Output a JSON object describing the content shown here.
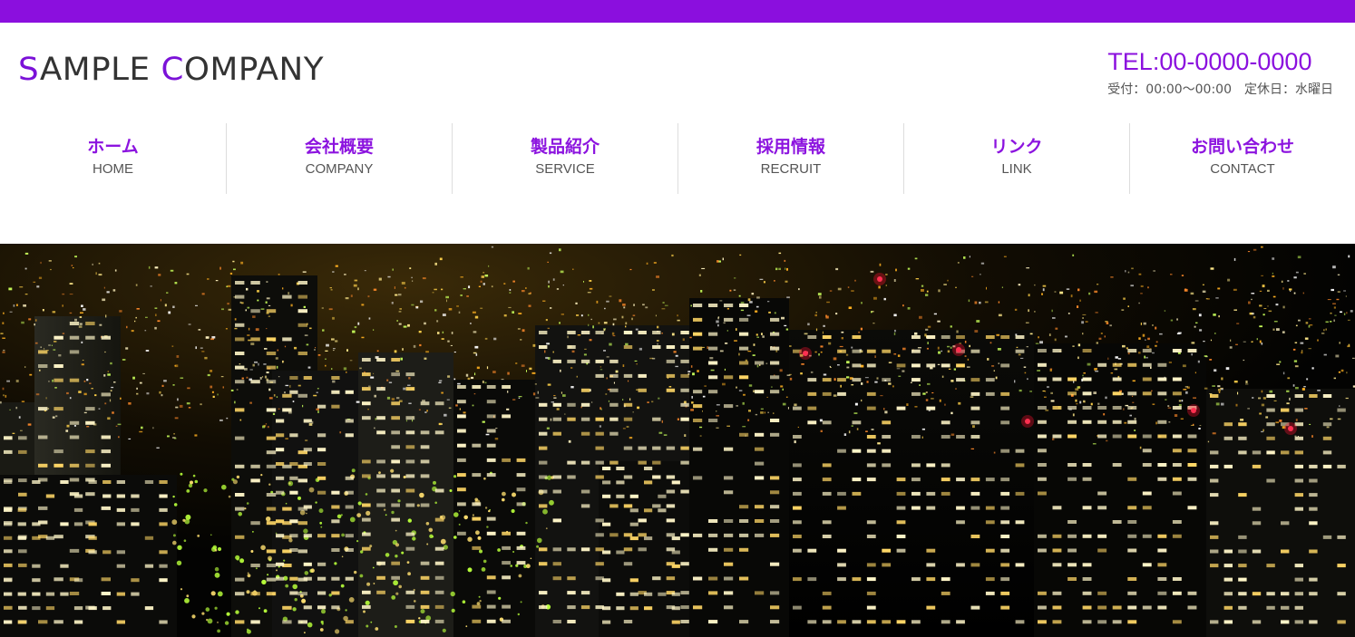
{
  "header": {
    "logo": {
      "first_initial": "S",
      "first_rest": "AMPLE ",
      "second_initial": "C",
      "second_rest": "OMPANY"
    },
    "tel": "TEL:00-0000-0000",
    "hours": "受付：00:00～00:00　定休日：水曜日"
  },
  "nav": {
    "items": [
      {
        "jp": "ホーム",
        "en": "HOME"
      },
      {
        "jp": "会社概要",
        "en": "COMPANY"
      },
      {
        "jp": "製品紹介",
        "en": "SERVICE"
      },
      {
        "jp": "採用情報",
        "en": "RECRUIT"
      },
      {
        "jp": "リンク",
        "en": "LINK"
      },
      {
        "jp": "お問い合わせ",
        "en": "CONTACT"
      }
    ]
  },
  "colors": {
    "brand": "#8b0fde",
    "text": "#333333",
    "subtext": "#555555",
    "divider": "#dddddd"
  },
  "hero": {
    "description_icon": "night-city-skyline-image"
  }
}
